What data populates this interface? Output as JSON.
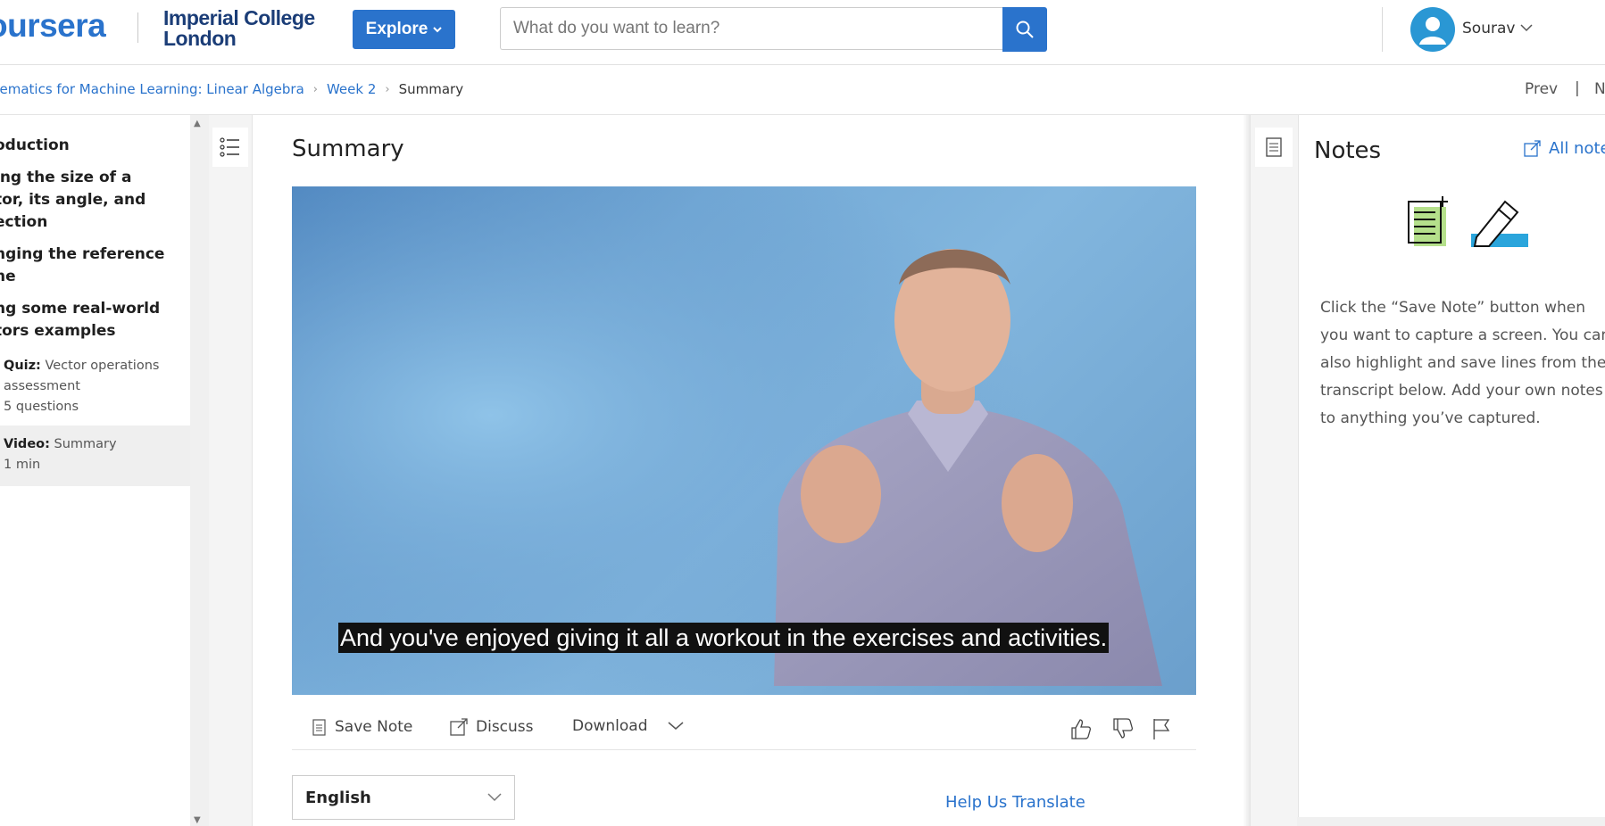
{
  "header": {
    "brand": "oursera",
    "partner_line1": "Imperial College",
    "partner_line2": "London",
    "explore_label": "Explore",
    "search_placeholder": "What do you want to learn?",
    "user_name": "Sourav"
  },
  "breadcrumb": {
    "course": "hematics for Machine Learning: Linear Algebra",
    "week": "Week 2",
    "current": "Summary"
  },
  "nav": {
    "prev": "Prev",
    "separator": "|",
    "next": "N"
  },
  "sidebar": {
    "headings": [
      "oduction",
      "ing the size of a tor, its angle, and ection",
      "nging the reference ne",
      "ng some real-world tors examples"
    ],
    "heading_lines": [
      [
        "oduction"
      ],
      [
        "ing the size of a",
        "tor, its angle, and",
        "ection"
      ],
      [
        "nging the reference",
        "ne"
      ],
      [
        "ng some real-world",
        "tors examples"
      ]
    ],
    "items": [
      {
        "type": "Quiz:",
        "title": "Vector operations",
        "title2": "assessment",
        "meta": "5 questions"
      },
      {
        "type": "Video:",
        "title": "Summary",
        "meta": "1 min"
      }
    ]
  },
  "lesson": {
    "title": "Summary",
    "caption": "And you've enjoyed giving it all a workout in the exercises and activities."
  },
  "toolbar": {
    "save_note": "Save Note",
    "discuss": "Discuss",
    "download": "Download"
  },
  "transcript": {
    "language": "English",
    "help_translate": "Help Us Translate"
  },
  "notes": {
    "title": "Notes",
    "all_notes": "All note",
    "help_text": "Click the “Save Note” button when you want to capture a screen. You can also highlight and save lines from the transcript below. Add your own notes to anything you’ve captured."
  },
  "colors": {
    "brand_blue": "#2a73cc",
    "partner_navy": "#1b3d77",
    "highlight_green": "#b5e08b",
    "highlight_blue": "#2aa5dc"
  }
}
